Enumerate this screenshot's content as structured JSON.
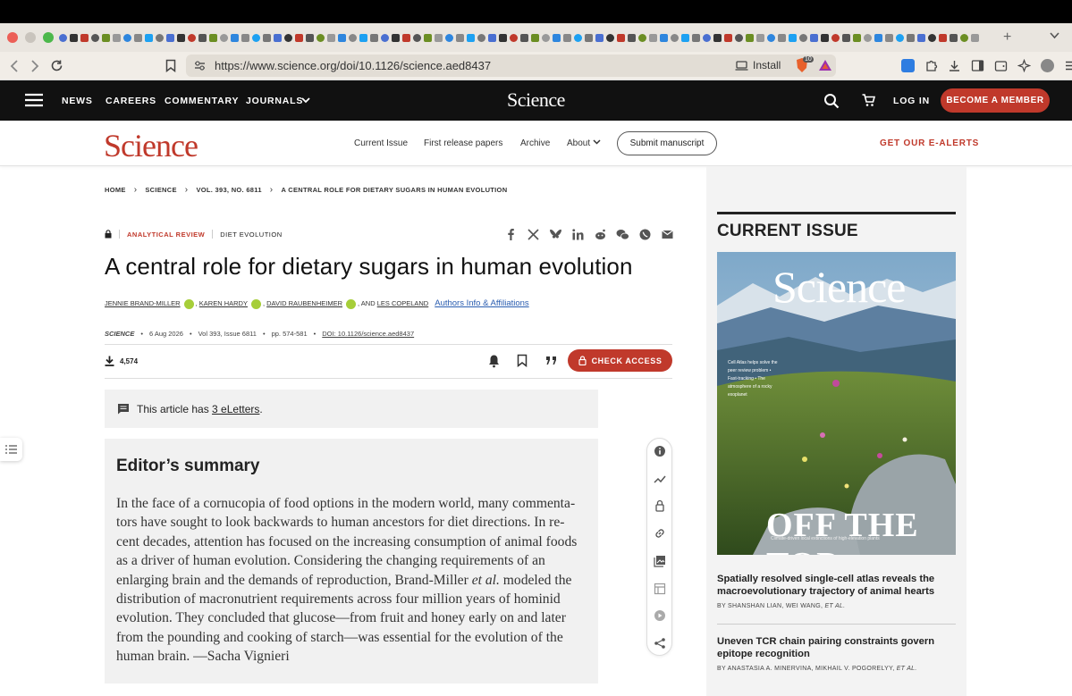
{
  "browser": {
    "url": "https://www.science.org/doi/10.1126/science.aed8437",
    "install_label": "Install",
    "shield_badge": "10"
  },
  "header": {
    "nav": [
      "NEWS",
      "CAREERS",
      "COMMENTARY",
      "JOURNALS"
    ],
    "logo": "Science",
    "login": "LOG IN",
    "member": "BECOME A MEMBER"
  },
  "subnav": {
    "logo": "Science",
    "links": [
      "Current Issue",
      "First release papers",
      "Archive",
      "About"
    ],
    "submit": "Submit manuscript",
    "alerts": "GET OUR E-ALERTS"
  },
  "breadcrumb": [
    "HOME",
    "SCIENCE",
    "VOL. 393, NO. 6811",
    "A CENTRAL ROLE FOR DIETARY SUGARS IN HUMAN EVOLUTION"
  ],
  "article": {
    "type": "ANALYTICAL REVIEW",
    "topic": "DIET EVOLUTION",
    "title": "A central role for dietary sugars in human evolution",
    "authors": [
      "JENNIE BRAND-MILLER",
      "KAREN HARDY",
      "DAVID RAUBENHEIMER",
      "LES COPELAND"
    ],
    "and_label": ", AND",
    "affiliations_link": "Authors Info & Affiliations",
    "journal": "SCIENCE",
    "date": "6 Aug 2026",
    "volume": "Vol 393, Issue 6811",
    "pages": "pp. 574-581",
    "doi": "DOI: 10.1126/science.aed8437",
    "downloads": "4,574",
    "check_access": "CHECK ACCESS",
    "eletters_prefix": "This article has",
    "eletters_link": "3 eLetters",
    "eletters_suffix": ".",
    "summary_heading": "Editor’s summary",
    "summary_before_etal": "In the face of a cornucopia of food options in the modern world, many commenta- tors have sought to look backwards to human ancestors for diet directions. In re- cent decades, attention has focused on the increasing consumption of animal foods as a driver of human evolution. Considering the changing requirements of an enlarging brain and the demands of reproduction, Brand-Miller",
    "summary_etal": "et al.",
    "summary_after_etal": "modeled the distribution of macronutrient requirements across four million years of hominid evolution. They concluded that glucose—from fruit and honey early on and later from the pounding and cooking of starch—was essential for the evolution of the human brain. —Sacha Vignieri"
  },
  "current_issue": {
    "heading": "CURRENT ISSUE",
    "cover_masthead": "Science",
    "cover_headline": "OFF THE TOP",
    "cover_subline": "Climate-driven local extinctions of high-elevation plants",
    "cover_side": "Cell Atlas helps solve the peer review problem • Fast-tracking • The atmosphere of a rocky exoplanet",
    "articles": [
      {
        "title": "Spatially resolved single-cell atlas reveals the macroevolutionary trajectory of animal hearts",
        "authors": [
          "BY SHANSHAN LIAN,",
          "WEI WANG,"
        ],
        "etal": "ET AL."
      },
      {
        "title": "Uneven TCR chain pairing constraints govern epitope recognition",
        "authors": [
          "BY ANASTASIA A. MINERVINA,",
          "MIKHAIL V. POGORELYY,"
        ],
        "etal": "ET AL."
      }
    ]
  },
  "colors": {
    "brand_red": "#c0392b",
    "header_black": "#111111",
    "link_blue": "#2a5db0",
    "panel_gray": "#f1f1f1"
  },
  "icons": [
    "hamburger-menu-icon",
    "search-icon",
    "cart-icon",
    "lock-icon",
    "facebook-icon",
    "x-icon",
    "bluesky-icon",
    "linkedin-icon",
    "reddit-icon",
    "wechat-icon",
    "whatsapp-icon",
    "email-icon",
    "download-icon",
    "bell-icon",
    "bookmark-icon",
    "quote-icon",
    "comment-icon",
    "info-icon",
    "metrics-icon",
    "link-icon",
    "images-icon",
    "tables-icon",
    "media-icon",
    "share-icon",
    "toc-icon"
  ]
}
